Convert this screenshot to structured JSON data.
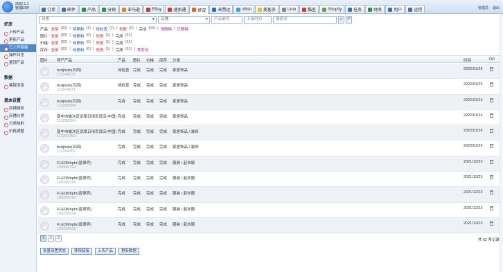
{
  "app": {
    "name_line1": "2022.1.1",
    "name_line2": "管理ERP"
  },
  "tabs": [
    {
      "label": "订单",
      "color": "#3c6fb8"
    },
    {
      "label": "邮件",
      "color": "#3c6fb8"
    },
    {
      "label": "产品",
      "color": "#2f8f3a"
    },
    {
      "label": "分销",
      "color": "#2f8f3a"
    },
    {
      "label": "亚马逊",
      "color": "#d28a1c"
    },
    {
      "label": "EBay",
      "color": "#c83b2a"
    },
    {
      "label": "速卖通",
      "color": "#d23a2a"
    },
    {
      "label": "虾皮",
      "color": "#e8641c"
    },
    {
      "label": "来赞达",
      "color": "#2b6fd6"
    },
    {
      "label": "Wish",
      "color": "#2ba9e0"
    },
    {
      "label": "美客多",
      "color": "#e7c21a"
    },
    {
      "label": "Unio",
      "color": "#888888"
    },
    {
      "label": "酷匠",
      "color": "#d03a2a"
    },
    {
      "label": "Shopify",
      "color": "#6aa33a"
    },
    {
      "label": "任务",
      "color": "#3c6fb8"
    },
    {
      "label": "财务",
      "color": "#2f8f3a"
    },
    {
      "label": "用户",
      "color": "#3c6fb8"
    },
    {
      "label": "远程",
      "color": "#3c6fb8"
    }
  ],
  "active_tab": "虾皮",
  "user": {
    "name": "管理员",
    "logout": "退出"
  },
  "sidebar": {
    "sections": [
      {
        "title": "虾皮",
        "items": [
          "上传产品",
          "更新产品",
          "已上传链接",
          "操作日志",
          "置顶产品"
        ]
      },
      {
        "title": "数据",
        "items": [
          "客服消息"
        ]
      },
      {
        "title": "基本设置",
        "items": [
          "店铺授权",
          "店铺分类",
          "分类映射",
          "价格调整"
        ]
      }
    ],
    "active_item": "已上传链接"
  },
  "filters": {
    "category_placeholder": "分类",
    "store_placeholder": "店铺",
    "sku_placeholder": "产品编号",
    "date_placeholder": "上架时间",
    "keyword_placeholder": "搜索词",
    "search_icon": "search-icon",
    "reset_icon": "undo-icon",
    "rows": [
      {
        "label": "产品:",
        "items": [
          {
            "text": "全部",
            "style": "red"
          },
          {
            "text": "(62)",
            "style": "dim"
          },
          {
            "text": "|",
            "style": "dim"
          },
          {
            "text": "待更新",
            "style": "blue"
          },
          {
            "text": "(1)",
            "style": "dim"
          },
          {
            "text": "|",
            "style": "dim"
          },
          {
            "text": "待检查",
            "style": "blue"
          },
          {
            "text": "(2)",
            "style": "dim"
          },
          {
            "text": "|",
            "style": "dim"
          },
          {
            "text": "失败",
            "style": "red"
          },
          {
            "text": "(0)",
            "style": "dim"
          },
          {
            "text": "|",
            "style": "dim"
          },
          {
            "text": "完成",
            "style": "plain"
          },
          {
            "text": "(59)",
            "style": "dim"
          },
          {
            "text": "|",
            "style": "dim"
          },
          {
            "text": "待删除",
            "style": "pur"
          },
          {
            "text": "|",
            "style": "dim"
          },
          {
            "text": "已删除",
            "style": "pur"
          }
        ]
      },
      {
        "label": "图片:",
        "items": [
          {
            "text": "全部",
            "style": "red"
          },
          {
            "text": "(62)",
            "style": "dim"
          },
          {
            "text": "|",
            "style": "dim"
          },
          {
            "text": "待更新",
            "style": "blue"
          },
          {
            "text": "(0)",
            "style": "dim"
          },
          {
            "text": "|",
            "style": "dim"
          },
          {
            "text": "失败",
            "style": "red"
          },
          {
            "text": "(1)",
            "style": "dim"
          },
          {
            "text": "|",
            "style": "dim"
          },
          {
            "text": "完成",
            "style": "plain"
          },
          {
            "text": "(61)",
            "style": "dim"
          }
        ]
      },
      {
        "label": "价格:",
        "items": [
          {
            "text": "全部",
            "style": "red"
          },
          {
            "text": "(62)",
            "style": "dim"
          },
          {
            "text": "|",
            "style": "dim"
          },
          {
            "text": "待更新",
            "style": "blue"
          },
          {
            "text": "(0)",
            "style": "dim"
          },
          {
            "text": "|",
            "style": "dim"
          },
          {
            "text": "失败",
            "style": "red"
          },
          {
            "text": "(1)",
            "style": "dim"
          },
          {
            "text": "|",
            "style": "dim"
          },
          {
            "text": "完成",
            "style": "plain"
          },
          {
            "text": "(61)",
            "style": "dim"
          }
        ]
      },
      {
        "label": "库存:",
        "items": [
          {
            "text": "全部",
            "style": "red"
          },
          {
            "text": "(62)",
            "style": "dim"
          },
          {
            "text": "|",
            "style": "dim"
          },
          {
            "text": "待更新",
            "style": "blue"
          },
          {
            "text": "(0)",
            "style": "dim"
          },
          {
            "text": "|",
            "style": "dim"
          },
          {
            "text": "失败",
            "style": "red"
          },
          {
            "text": "(1)",
            "style": "dim"
          },
          {
            "text": "|",
            "style": "dim"
          },
          {
            "text": "完成",
            "style": "plain"
          },
          {
            "text": "(61)",
            "style": "dim"
          },
          {
            "text": "|",
            "style": "dim"
          },
          {
            "text": "零库存",
            "style": "pur"
          }
        ]
      }
    ]
  },
  "table": {
    "headers": {
      "image": "图片",
      "product": "停产产品",
      "c1": "产品",
      "c2": "图片",
      "c3": "价格",
      "c4": "库存",
      "c5": "分类",
      "time": "时间",
      "op": "OP"
    },
    "rows": [
      {
        "name": "bxdjhsbr(五四)",
        "sku": "113244571",
        "c1": "待检查",
        "c2": "完成",
        "c3": "完成",
        "c4": "完成",
        "c5": "家居饰品",
        "time": "2022/01/25"
      },
      {
        "name": "bxdjhsbr(五四)",
        "sku": "113244571",
        "c1": "待检查",
        "c2": "完成",
        "c3": "完成",
        "c4": "完成",
        "c5": "家居饰品",
        "time": "2022/01/25"
      },
      {
        "name": "bxdjhsbr(五四)",
        "sku": "113208394",
        "c1": "完成",
        "c2": "完成",
        "c3": "完成",
        "c4": "完成",
        "c5": "家居饰品",
        "time": "2022/01/24"
      },
      {
        "name": "晋中市榆次区武陌日用百货店(中国)",
        "sku": "113208394",
        "c1": "完成",
        "c2": "完成",
        "c3": "完成",
        "c4": "完成",
        "c5": "家居饰品",
        "time": "2022/01/24"
      },
      {
        "name": "晋中市榆次区武陌日用百货店(中国)",
        "sku": "113204352",
        "c1": "完成",
        "c2": "完成",
        "c3": "完成",
        "c4": "完成",
        "c5": "家居饰品 / 装饰",
        "time": "2022/01/24"
      },
      {
        "name": "bxdjhsbr(五四)",
        "sku": "113204352",
        "c1": "完成",
        "c2": "完成",
        "c3": "完成",
        "c4": "完成",
        "c5": "家居饰品 / 装饰",
        "time": "2022/01/24"
      },
      {
        "name": "FLEDMhphr(兽律宾)",
        "sku": "109265763",
        "c1": "完成",
        "c2": "完成",
        "c3": "完成",
        "c4": "完成",
        "c5": "服装 / 起衣服",
        "time": "2021/12/23"
      },
      {
        "name": "FLEDMhphr(兽律宾)",
        "sku": "109265740",
        "c1": "完成",
        "c2": "完成",
        "c3": "完成",
        "c4": "完成",
        "c5": "服装 / 起衣服",
        "time": "2021/12/23"
      },
      {
        "name": "FLEDMhphr(兽律宾)",
        "sku": "109265783",
        "c1": "完成",
        "c2": "完成",
        "c3": "完成",
        "c4": "完成",
        "c5": "服装 / 起衣服",
        "time": "2021/12/23"
      },
      {
        "name": "FLEDMhphr(兽律宾)",
        "sku": "109250614",
        "c1": "完成",
        "c2": "完成",
        "c3": "完成",
        "c4": "完成",
        "c5": "服装 / 起衣服",
        "time": "2021/12/23"
      },
      {
        "name": "FLEDMhphr(兽律宾)",
        "sku": "109250630",
        "c1": "完成",
        "c2": "完成",
        "c3": "完成",
        "c4": "完成",
        "c5": "服装 / 起衣服",
        "time": "2021/12/23"
      }
    ]
  },
  "pagination": {
    "pages": [
      "1",
      "2",
      "3"
    ],
    "current": "1",
    "total_text": "共 62 条记录"
  },
  "actions": {
    "batch_status": "批量设置状态",
    "delete_link": "移除链接",
    "upload": "上传产品",
    "update": "更新数据"
  }
}
